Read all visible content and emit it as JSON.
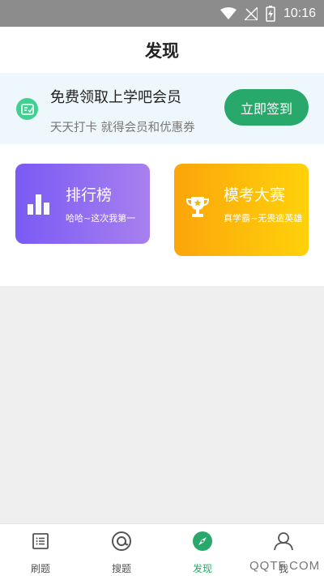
{
  "status_bar": {
    "time": "10:16"
  },
  "header": {
    "title": "发现"
  },
  "banner": {
    "title": "免费领取上学吧会员",
    "subtitle": "天天打卡 就得会员和优惠券",
    "button_label": "立即签到"
  },
  "cards": [
    {
      "title": "排行榜",
      "subtitle": "哈哈~这次我第一",
      "icon": "bar-chart-icon"
    },
    {
      "title": "模考大赛",
      "subtitle": "真学霸~无畏造英雄",
      "icon": "trophy-icon"
    }
  ],
  "nav": [
    {
      "label": "刷题",
      "icon": "list-icon"
    },
    {
      "label": "搜题",
      "icon": "search-at-icon"
    },
    {
      "label": "发现",
      "icon": "compass-icon",
      "active": true
    },
    {
      "label": "我",
      "icon": "person-icon"
    }
  ],
  "watermark": "QQTF.COM",
  "colors": {
    "accent_green": "#28a86a",
    "rank_gradient": [
      "#7a5af5",
      "#a880ee"
    ],
    "exam_gradient": [
      "#fba50a",
      "#ffd20a"
    ]
  }
}
